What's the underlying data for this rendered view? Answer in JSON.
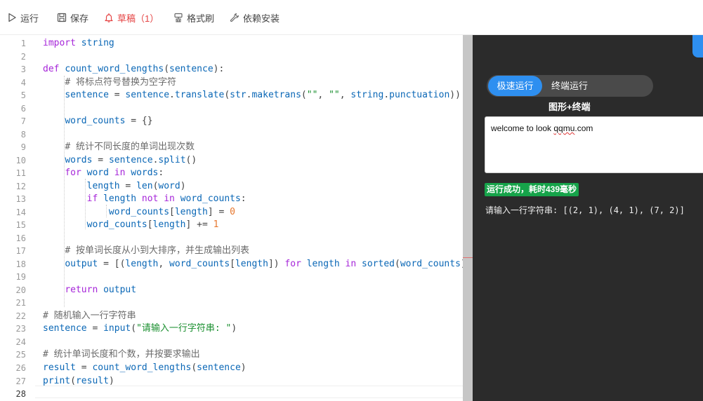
{
  "toolbar": {
    "run": "运行",
    "save": "保存",
    "draft": "草稿（1）",
    "format": "格式刷",
    "deps": "依赖安装"
  },
  "editor": {
    "current_line": 28,
    "lines": [
      {
        "n": "1",
        "t": [
          [
            "kw",
            "import"
          ],
          [
            "pu",
            " "
          ],
          [
            "bl",
            "string"
          ]
        ]
      },
      {
        "n": "2",
        "t": []
      },
      {
        "n": "3",
        "t": [
          [
            "kw",
            "def"
          ],
          [
            "pu",
            " "
          ],
          [
            "fn",
            "count_word_lengths"
          ],
          [
            "pu",
            "("
          ],
          [
            "bl",
            "sentence"
          ],
          [
            "pu",
            "):"
          ]
        ]
      },
      {
        "n": "4",
        "t": [
          [
            "pu",
            "    "
          ],
          [
            "cm",
            "# 将标点符号替换为空字符"
          ]
        ]
      },
      {
        "n": "5",
        "t": [
          [
            "pu",
            "    "
          ],
          [
            "bl",
            "sentence"
          ],
          [
            "pu",
            " = "
          ],
          [
            "bl",
            "sentence"
          ],
          [
            "pu",
            "."
          ],
          [
            "fn",
            "translate"
          ],
          [
            "pu",
            "("
          ],
          [
            "fn",
            "str"
          ],
          [
            "pu",
            "."
          ],
          [
            "fn",
            "maketrans"
          ],
          [
            "pu",
            "("
          ],
          [
            "st",
            "\"\""
          ],
          [
            "pu",
            ", "
          ],
          [
            "st",
            "\"\""
          ],
          [
            "pu",
            ", "
          ],
          [
            "bl",
            "string"
          ],
          [
            "pu",
            "."
          ],
          [
            "bl",
            "punctuation"
          ],
          [
            "pu",
            "))"
          ]
        ]
      },
      {
        "n": "6",
        "t": []
      },
      {
        "n": "7",
        "t": [
          [
            "pu",
            "    "
          ],
          [
            "bl",
            "word_counts"
          ],
          [
            "pu",
            " = {}"
          ]
        ]
      },
      {
        "n": "8",
        "t": []
      },
      {
        "n": "9",
        "t": [
          [
            "pu",
            "    "
          ],
          [
            "cm",
            "# 统计不同长度的单词出现次数"
          ]
        ]
      },
      {
        "n": "10",
        "t": [
          [
            "pu",
            "    "
          ],
          [
            "bl",
            "words"
          ],
          [
            "pu",
            " = "
          ],
          [
            "bl",
            "sentence"
          ],
          [
            "pu",
            "."
          ],
          [
            "fn",
            "split"
          ],
          [
            "pu",
            "()"
          ]
        ]
      },
      {
        "n": "11",
        "t": [
          [
            "pu",
            "    "
          ],
          [
            "kw",
            "for"
          ],
          [
            "pu",
            " "
          ],
          [
            "bl",
            "word"
          ],
          [
            "pu",
            " "
          ],
          [
            "kw",
            "in"
          ],
          [
            "pu",
            " "
          ],
          [
            "bl",
            "words"
          ],
          [
            "pu",
            ":"
          ]
        ]
      },
      {
        "n": "12",
        "t": [
          [
            "pu",
            "        "
          ],
          [
            "bl",
            "length"
          ],
          [
            "pu",
            " = "
          ],
          [
            "fn",
            "len"
          ],
          [
            "pu",
            "("
          ],
          [
            "bl",
            "word"
          ],
          [
            "pu",
            ")"
          ]
        ]
      },
      {
        "n": "13",
        "t": [
          [
            "pu",
            "        "
          ],
          [
            "kw",
            "if"
          ],
          [
            "pu",
            " "
          ],
          [
            "bl",
            "length"
          ],
          [
            "pu",
            " "
          ],
          [
            "kw",
            "not in"
          ],
          [
            "pu",
            " "
          ],
          [
            "bl",
            "word_counts"
          ],
          [
            "pu",
            ":"
          ]
        ]
      },
      {
        "n": "14",
        "t": [
          [
            "pu",
            "            "
          ],
          [
            "bl",
            "word_counts"
          ],
          [
            "pu",
            "["
          ],
          [
            "bl",
            "length"
          ],
          [
            "pu",
            "] = "
          ],
          [
            "nm",
            "0"
          ]
        ]
      },
      {
        "n": "15",
        "t": [
          [
            "pu",
            "        "
          ],
          [
            "bl",
            "word_counts"
          ],
          [
            "pu",
            "["
          ],
          [
            "bl",
            "length"
          ],
          [
            "pu",
            "] += "
          ],
          [
            "nm",
            "1"
          ]
        ]
      },
      {
        "n": "16",
        "t": []
      },
      {
        "n": "17",
        "t": [
          [
            "pu",
            "    "
          ],
          [
            "cm",
            "# 按单词长度从小到大排序，并生成输出列表"
          ]
        ]
      },
      {
        "n": "18",
        "t": [
          [
            "pu",
            "    "
          ],
          [
            "bl",
            "output"
          ],
          [
            "pu",
            " = [("
          ],
          [
            "bl",
            "length"
          ],
          [
            "pu",
            ", "
          ],
          [
            "bl",
            "word_counts"
          ],
          [
            "pu",
            "["
          ],
          [
            "bl",
            "length"
          ],
          [
            "pu",
            "]) "
          ],
          [
            "kw",
            "for"
          ],
          [
            "pu",
            " "
          ],
          [
            "bl",
            "length"
          ],
          [
            "pu",
            " "
          ],
          [
            "kw",
            "in"
          ],
          [
            "pu",
            " "
          ],
          [
            "fn",
            "sorted"
          ],
          [
            "pu",
            "("
          ],
          [
            "bl",
            "word_counts"
          ],
          [
            "pu",
            ")]"
          ]
        ]
      },
      {
        "n": "19",
        "t": []
      },
      {
        "n": "20",
        "t": [
          [
            "pu",
            "    "
          ],
          [
            "kw",
            "return"
          ],
          [
            "pu",
            " "
          ],
          [
            "bl",
            "output"
          ]
        ]
      },
      {
        "n": "21",
        "t": []
      },
      {
        "n": "22",
        "t": [
          [
            "cm",
            "# 随机输入一行字符串"
          ]
        ]
      },
      {
        "n": "23",
        "t": [
          [
            "bl",
            "sentence"
          ],
          [
            "pu",
            " = "
          ],
          [
            "fn",
            "input"
          ],
          [
            "pu",
            "("
          ],
          [
            "st",
            "\"请输入一行字符串: \""
          ],
          [
            "pu",
            ")"
          ]
        ]
      },
      {
        "n": "24",
        "t": []
      },
      {
        "n": "25",
        "t": [
          [
            "cm",
            "# 统计单词长度和个数，并按要求输出"
          ]
        ]
      },
      {
        "n": "26",
        "t": [
          [
            "bl",
            "result"
          ],
          [
            "pu",
            " = "
          ],
          [
            "fn",
            "count_word_lengths"
          ],
          [
            "pu",
            "("
          ],
          [
            "bl",
            "sentence"
          ],
          [
            "pu",
            ")"
          ]
        ]
      },
      {
        "n": "27",
        "t": [
          [
            "fn",
            "print"
          ],
          [
            "pu",
            "("
          ],
          [
            "bl",
            "result"
          ],
          [
            "pu",
            ")"
          ]
        ]
      },
      {
        "n": "28",
        "t": []
      }
    ]
  },
  "output_panel": {
    "mode_fast": "极速运行",
    "mode_terminal": "终端运行",
    "mode_graphics": "图形+终端",
    "stdin_before": "welcome to look ",
    "stdin_misspelled": "qqmu",
    "stdin_after": ".com",
    "status": "运行成功，耗时439毫秒",
    "result": "请输入一行字符串: [(2, 1), (4, 1), (7, 2)]"
  },
  "colors": {
    "accent": "#2e8ff0",
    "draft": "#e54545",
    "success": "#16a34a",
    "panel_bg": "#2b2b2b"
  }
}
